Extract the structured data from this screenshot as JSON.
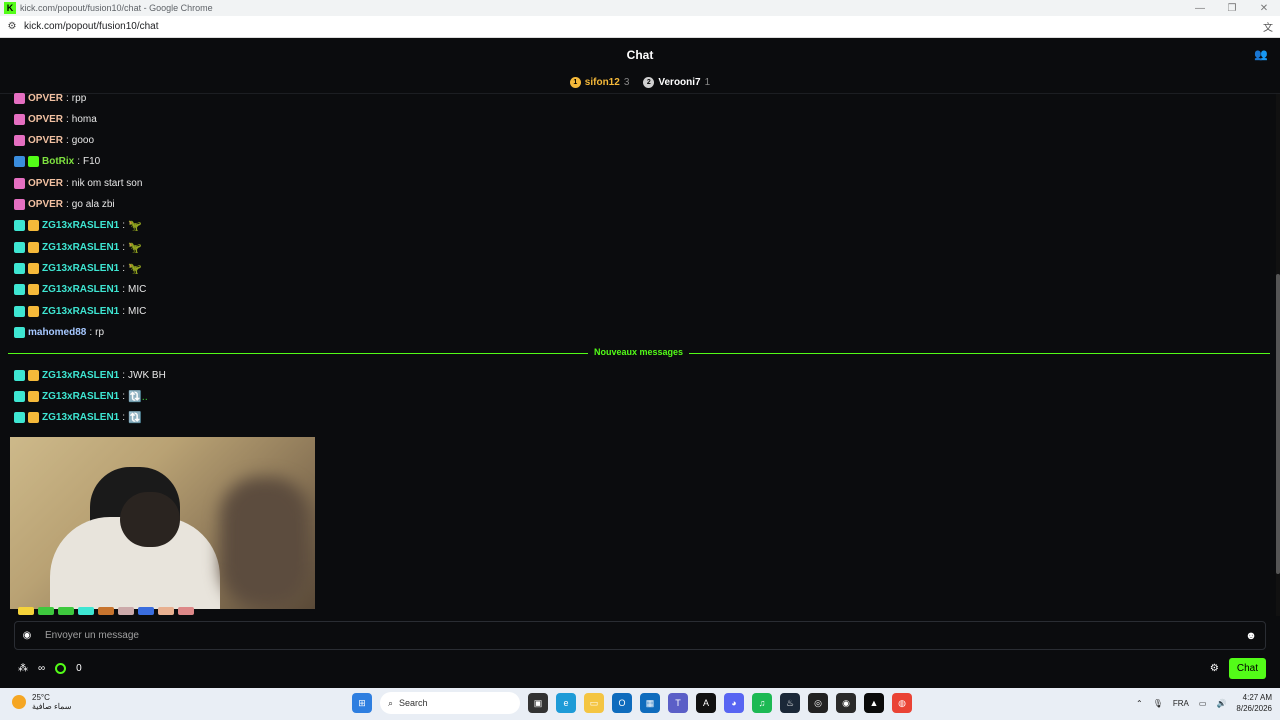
{
  "browser": {
    "window_title": "kick.com/popout/fusion10/chat - Google Chrome",
    "url": "kick.com/popout/fusion10/chat"
  },
  "header": {
    "title": "Chat"
  },
  "leaderboard": [
    {
      "name": "sifon12",
      "count": "3",
      "medal": "1",
      "color": "#f5b93a"
    },
    {
      "name": "Verooni7",
      "count": "1",
      "medal": "2",
      "color": "#d0d0d0"
    }
  ],
  "messages": [
    {
      "user": "OPVER",
      "text": "rpp",
      "user_color": "#f2c1a2",
      "badges": [
        "#e56fc1"
      ]
    },
    {
      "user": "OPVER",
      "text": "homa",
      "user_color": "#f2c1a2",
      "badges": [
        "#e56fc1"
      ]
    },
    {
      "user": "OPVER",
      "text": "gooo",
      "user_color": "#f2c1a2",
      "badges": [
        "#e56fc1"
      ]
    },
    {
      "user": "BotRix",
      "text": "F10",
      "user_color": "#7ee23f",
      "badges": [
        "#3a8dde",
        "#53fc18"
      ]
    },
    {
      "user": "OPVER",
      "text": "nik om start son",
      "user_color": "#f2c1a2",
      "badges": [
        "#e56fc1"
      ]
    },
    {
      "user": "OPVER",
      "text": "go ala zbi",
      "user_color": "#f2c1a2",
      "badges": [
        "#e56fc1"
      ]
    },
    {
      "user": "ZG13xRASLEN1",
      "text": "",
      "emote": "🦖",
      "user_color": "#3ee6d2",
      "badges": [
        "#3ee6d2",
        "#f5b93a"
      ]
    },
    {
      "user": "ZG13xRASLEN1",
      "text": "",
      "emote": "🦖",
      "user_color": "#3ee6d2",
      "badges": [
        "#3ee6d2",
        "#f5b93a"
      ]
    },
    {
      "user": "ZG13xRASLEN1",
      "text": "",
      "emote": "🦖",
      "user_color": "#3ee6d2",
      "badges": [
        "#3ee6d2",
        "#f5b93a"
      ]
    },
    {
      "user": "ZG13xRASLEN1",
      "text": "MIC",
      "user_color": "#3ee6d2",
      "badges": [
        "#3ee6d2",
        "#f5b93a"
      ]
    },
    {
      "user": "ZG13xRASLEN1",
      "text": "MIC",
      "user_color": "#3ee6d2",
      "badges": [
        "#3ee6d2",
        "#f5b93a"
      ]
    },
    {
      "user": "mahomed88",
      "text": "rp",
      "user_color": "#a6c8ff",
      "badges": [
        "#3ee6d2"
      ]
    }
  ],
  "divider_label": "Nouveaux messages",
  "new_messages": [
    {
      "user": "ZG13xRASLEN1",
      "text": "JWK BH",
      "user_color": "#3ee6d2",
      "badges": [
        "#3ee6d2",
        "#f5b93a"
      ]
    },
    {
      "user": "ZG13xRASLEN1",
      "text": "",
      "emote": "🔃..",
      "user_color": "#3ee6d2",
      "badges": [
        "#3ee6d2",
        "#f5b93a"
      ]
    },
    {
      "user": "ZG13xRASLEN1",
      "text": "",
      "emote": "🔃",
      "user_color": "#3ee6d2",
      "badges": [
        "#3ee6d2",
        "#f5b93a"
      ]
    }
  ],
  "input": {
    "placeholder": "Envoyer un message"
  },
  "bottom": {
    "infinity": "∞",
    "points": "0",
    "send_label": "Chat"
  },
  "colors": {
    "accent": "#53fc18",
    "background": "#0b0c0e"
  },
  "taskbar": {
    "temperature": "25°C",
    "weather_desc": "سماء صافية",
    "search_label": "Search",
    "language": "FRA",
    "time": "4:27 AM",
    "date": "8/26/2026"
  }
}
